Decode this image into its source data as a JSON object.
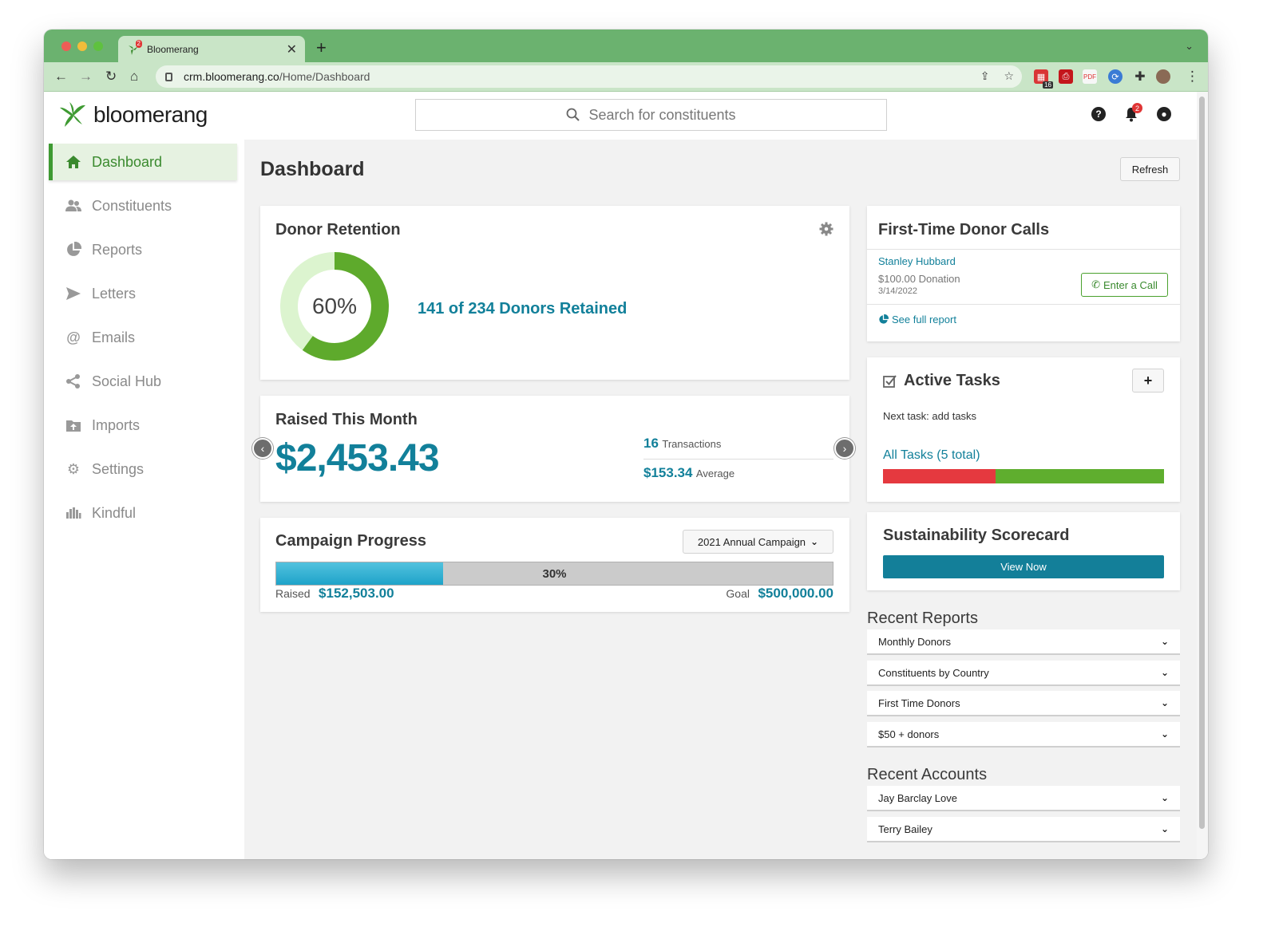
{
  "browser": {
    "tab_title": "Bloomerang",
    "tab_favicon_badge": "2",
    "url_host": "crm.bloomerang.co",
    "url_path": "/Home/Dashboard",
    "extension_badge": "16"
  },
  "app": {
    "logo_text": "bloomerang",
    "search_placeholder": "Search for constituents",
    "notification_count": "2"
  },
  "sidebar": {
    "items": [
      {
        "label": "Dashboard",
        "icon": "home-icon",
        "active": true
      },
      {
        "label": "Constituents",
        "icon": "people-icon"
      },
      {
        "label": "Reports",
        "icon": "pie-chart-icon"
      },
      {
        "label": "Letters",
        "icon": "send-icon"
      },
      {
        "label": "Emails",
        "icon": "at-icon"
      },
      {
        "label": "Social Hub",
        "icon": "share-icon"
      },
      {
        "label": "Imports",
        "icon": "folder-upload-icon"
      },
      {
        "label": "Settings",
        "icon": "gear-icon"
      },
      {
        "label": "Kindful",
        "icon": "kindful-icon"
      }
    ]
  },
  "page": {
    "title": "Dashboard",
    "refresh_label": "Refresh"
  },
  "donor_retention": {
    "title": "Donor Retention",
    "percent_label": "60%",
    "retention_fraction": 0.6,
    "retained_text": "141 of 234 Donors Retained"
  },
  "raised": {
    "title": "Raised This Month",
    "amount": "$2,453.43",
    "transactions_count": "16",
    "transactions_label": "Transactions",
    "average_amount": "$153.34",
    "average_label": "Average"
  },
  "campaign": {
    "title": "Campaign Progress",
    "selected": "2021 Annual Campaign",
    "percent_label": "30%",
    "progress_fraction": 0.3,
    "raised_label": "Raised",
    "raised_amount": "$152,503.00",
    "goal_label": "Goal",
    "goal_amount": "$500,000.00"
  },
  "first_time_calls": {
    "title": "First-Time Donor Calls",
    "donor_name": "Stanley Hubbard",
    "donation": "$100.00 Donation",
    "date": "3/14/2022",
    "enter_call_label": "Enter a Call",
    "see_report_label": "See full report"
  },
  "tasks": {
    "title": "Active Tasks",
    "add_label": "+",
    "next_task": "Next task: add tasks",
    "all_tasks_link": "All Tasks (5 total)",
    "overdue_fraction": 0.4,
    "colors": {
      "overdue": "#e5393f",
      "ontime": "#5fae2e"
    }
  },
  "sustainability": {
    "title": "Sustainability Scorecard",
    "button_label": "View Now"
  },
  "recent_reports": {
    "title": "Recent Reports",
    "items": [
      "Monthly Donors",
      "Constituents by Country",
      "First Time Donors",
      "$50 + donors"
    ]
  },
  "recent_accounts": {
    "title": "Recent Accounts",
    "items": [
      "Jay Barclay Love",
      "Terry Bailey"
    ]
  },
  "colors": {
    "brand_green": "#3e9a32",
    "teal": "#12809a",
    "tab_strip": "#6bb26f"
  }
}
